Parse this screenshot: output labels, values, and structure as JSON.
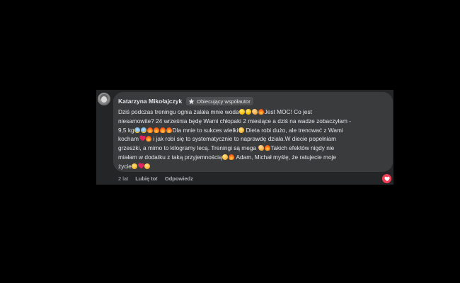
{
  "comment": {
    "author": "Katarzyna Mikołajczyk",
    "badge_label": "Obiecujący współautor",
    "lines": {
      "l1": {
        "a": "Dziś podczas treningu ognia zalała mnie woda",
        "b": "Jest MOC! Co jest"
      },
      "l2": {
        "a": "niesamowite? 24 września będę Wami chłopaki 2 miesiące a dziś na wadze zobaczyłam -"
      },
      "l3": {
        "a": "9,5 kg",
        "b": "Dla mnie to sukces wielki",
        "c": " Dieta robi dużo, ale trenować z Wami"
      },
      "l4": {
        "a": "kocham",
        "b": " i jak robi się to systematycznie to naprawdę działa.W diecie popełniam"
      },
      "l5": {
        "a": "grzeszki, a mimo to kilogramy lecą. Treningi są mega ",
        "b": "Takich efektów nigdy nie"
      },
      "l6": {
        "a": "miałam w dodatku z taką przyjemnością",
        "b": " Adam, Michał myślę, że ratujecie moje"
      },
      "l7": {
        "a": "życie"
      }
    },
    "emoji": {
      "laugh": "face-with-tears-of-joy-emoji",
      "muscle": "flexed-biceps-emoji",
      "fire": "fire-emoji",
      "scream": "screaming-face-emoji",
      "hug": "hugging-face-emoji",
      "heart": "red-heart-emoji",
      "kiss": "kissing-face-emoji"
    }
  },
  "actions": {
    "time": "2 lat",
    "like_label": "Lubię to!",
    "reply_label": "Odpowiedz"
  },
  "reaction": {
    "type": "love",
    "color": "#f33e58"
  },
  "colors": {
    "background": "#000000",
    "panel": "#242526",
    "bubble": "#3a3b3c",
    "text": "#e4e6eb",
    "secondary_text": "#b0b3b8"
  }
}
